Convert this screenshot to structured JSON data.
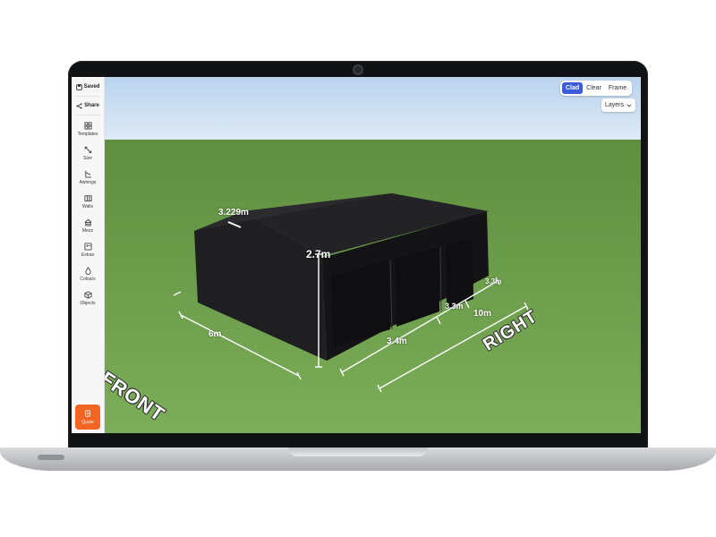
{
  "sidebar": {
    "saved_label": "Saved",
    "share_label": "Share",
    "items": [
      {
        "label": "Templates",
        "icon": "grid-icon"
      },
      {
        "label": "Size",
        "icon": "resize-icon"
      },
      {
        "label": "Awnings",
        "icon": "awning-icon"
      },
      {
        "label": "Walls",
        "icon": "walls-icon"
      },
      {
        "label": "Mezz",
        "icon": "mezzanine-icon"
      },
      {
        "label": "Extras",
        "icon": "extras-icon"
      },
      {
        "label": "Colours",
        "icon": "droplet-icon"
      },
      {
        "label": "Objects",
        "icon": "cube-icon"
      }
    ],
    "quote_label": "Quote",
    "quote_color": "#f26522"
  },
  "view_toggle": {
    "options": [
      "Clad",
      "Clear",
      "Frame"
    ],
    "active": "Clad",
    "active_color": "#3b5bdb"
  },
  "layers_label": "Layers",
  "dimensions": {
    "roof_slope": "3.229m",
    "wall_height": "2.7m",
    "front_width": "6m",
    "bay_1": "3.4m",
    "bay_2": "3.3m",
    "bay_3": "3.3m",
    "total_length": "10m"
  },
  "side_labels": {
    "front": "FRONT",
    "right": "RIGHT"
  },
  "colors": {
    "building": "#1b1b1d",
    "grass": "#6fa04e",
    "sky": "#c7dcf2"
  }
}
